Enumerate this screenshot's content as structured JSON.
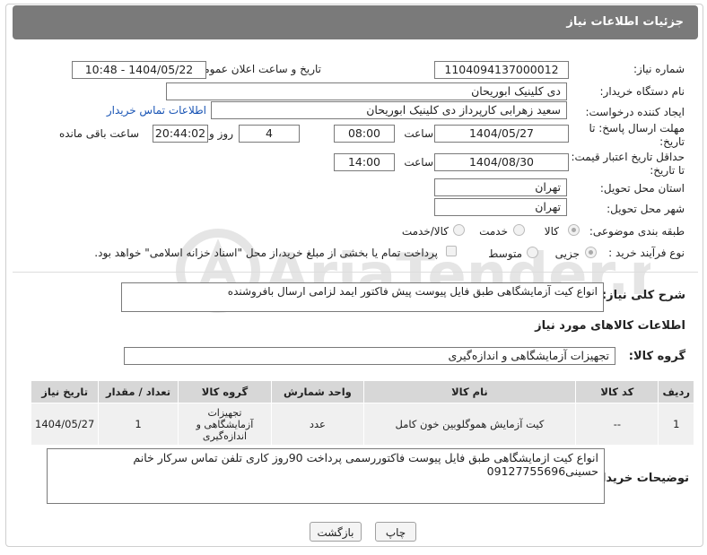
{
  "header": {
    "title": "جزئیات اطلاعات نیاز"
  },
  "form": {
    "need_number_label": "شماره نیاز:",
    "need_number": "1104094137000012",
    "announce_label": "تاریخ و ساعت اعلان عمومی:",
    "announce_value": "1404/05/22 - 10:48",
    "buyer_org_label": "نام دستگاه خریدار:",
    "buyer_org": "دی کلینیک ابوریحان",
    "requester_label": "ایجاد کننده درخواست:",
    "requester": "سعید زهرابی کارپرداز دی کلینیک ابوریحان",
    "contact_link": "اطلاعات تماس خریدار",
    "reply_deadline_label": "مهلت ارسال پاسخ: تا تاریخ:",
    "reply_date": "1404/05/27",
    "time_label": "ساعت",
    "reply_time": "08:00",
    "days_value": "4",
    "days_label": "روز و",
    "remaining_time": "20:44:02",
    "remaining_label": "ساعت باقی مانده",
    "validity_label": "حداقل تاریخ اعتبار قیمت: تا تاریخ:",
    "validity_date": "1404/08/30",
    "validity_time": "14:00",
    "province_label": "استان محل تحویل:",
    "province": "تهران",
    "city_label": "شهر محل تحویل:",
    "city": "تهران",
    "category_label": "طبقه بندی موضوعی:",
    "category_options": [
      "کالا",
      "خدمت",
      "کالا/خدمت"
    ],
    "process_label": "نوع فرآیند خرید :",
    "process_options": [
      "جزیی",
      "متوسط"
    ],
    "process_note": "پرداخت تمام یا بخشی از مبلغ خرید،از محل \"اسناد خزانه اسلامی\" خواهد بود."
  },
  "description": {
    "label": "شرح کلی نیاز:",
    "text": "انواع کیت آزمایشگاهی طبق فایل پیوست پیش فاکتور ایمد لزامی ارسال بافروشنده"
  },
  "goods": {
    "section_title": "اطلاعات کالاهای مورد نیاز",
    "group_label": "گروه کالا:",
    "group_value": "تجهیزات آزمایشگاهی و اندازه‌گیری",
    "columns": [
      "ردیف",
      "کد کالا",
      "نام کالا",
      "واحد شمارش",
      "گروه کالا",
      "تعداد / مقدار",
      "تاریخ نیاز"
    ],
    "rows": [
      {
        "index": "1",
        "code": "--",
        "name": "کیت آزمایش هموگلوبین خون کامل",
        "unit": "عدد",
        "group": "تجهیزات آزمایشگاهی و اندازه‌گیری",
        "qty": "1",
        "date": "1404/05/27"
      }
    ]
  },
  "buyer_notes": {
    "label": "توضیحات خریدار:",
    "text": "انواع کیت ازمایشگاهی طبق فایل پیوست فاکتوررسمی پرداخت 90روز کاری تلفن تماس سرکار خانم حسینی09127755696"
  },
  "buttons": {
    "print": "چاپ",
    "back": "بازگشت"
  },
  "watermark": {
    "text": "AriaTender.net"
  },
  "colors": {
    "header": "#7a7a7a",
    "link": "#1a55b5",
    "table_header": "#d7d7d7"
  }
}
